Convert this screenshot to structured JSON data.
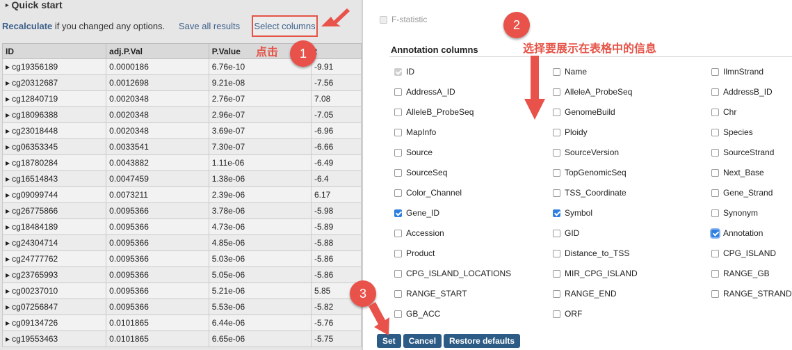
{
  "left": {
    "quick_start": "Quick start",
    "recalculate": "Recalculate",
    "recalc_suffix": " if you changed any options.",
    "save_all": "Save all results",
    "select_columns": "Select columns",
    "headers": [
      "ID",
      "adj.P.Val",
      "P.Value",
      "t"
    ],
    "rows": [
      [
        "cg19356189",
        "0.0000186",
        "6.76e-10",
        "-9.91"
      ],
      [
        "cg20312687",
        "0.0012698",
        "9.21e-08",
        "-7.56"
      ],
      [
        "cg12840719",
        "0.0020348",
        "2.76e-07",
        "7.08"
      ],
      [
        "cg18096388",
        "0.0020348",
        "2.96e-07",
        "-7.05"
      ],
      [
        "cg23018448",
        "0.0020348",
        "3.69e-07",
        "-6.96"
      ],
      [
        "cg06353345",
        "0.0033541",
        "7.30e-07",
        "-6.66"
      ],
      [
        "cg18780284",
        "0.0043882",
        "1.11e-06",
        "-6.49"
      ],
      [
        "cg16514843",
        "0.0047459",
        "1.38e-06",
        "-6.4"
      ],
      [
        "cg09099744",
        "0.0073211",
        "2.39e-06",
        "6.17"
      ],
      [
        "cg26775866",
        "0.0095366",
        "3.78e-06",
        "-5.98"
      ],
      [
        "cg18484189",
        "0.0095366",
        "4.73e-06",
        "-5.89"
      ],
      [
        "cg24304714",
        "0.0095366",
        "4.85e-06",
        "-5.88"
      ],
      [
        "cg24777762",
        "0.0095366",
        "5.03e-06",
        "-5.86"
      ],
      [
        "cg23765993",
        "0.0095366",
        "5.05e-06",
        "-5.86"
      ],
      [
        "cg00237010",
        "0.0095366",
        "5.21e-06",
        "5.85"
      ],
      [
        "cg07256847",
        "0.0095366",
        "5.53e-06",
        "-5.82"
      ],
      [
        "cg09134726",
        "0.0101865",
        "6.44e-06",
        "-5.76"
      ],
      [
        "cg19553463",
        "0.0101865",
        "6.65e-06",
        "-5.75"
      ]
    ]
  },
  "right": {
    "f_statistic": "F-statistic",
    "annotation_title": "Annotation columns",
    "options": [
      {
        "label": "ID",
        "checked": true,
        "disabled": true
      },
      {
        "label": "Name",
        "checked": false
      },
      {
        "label": "IlmnStrand",
        "checked": false
      },
      {
        "label": "AddressA_ID",
        "checked": false
      },
      {
        "label": "AlleleA_ProbeSeq",
        "checked": false
      },
      {
        "label": "AddressB_ID",
        "checked": false
      },
      {
        "label": "AlleleB_ProbeSeq",
        "checked": false
      },
      {
        "label": "GenomeBuild",
        "checked": false
      },
      {
        "label": "Chr",
        "checked": false
      },
      {
        "label": "MapInfo",
        "checked": false
      },
      {
        "label": "Ploidy",
        "checked": false
      },
      {
        "label": "Species",
        "checked": false
      },
      {
        "label": "Source",
        "checked": false
      },
      {
        "label": "SourceVersion",
        "checked": false
      },
      {
        "label": "SourceStrand",
        "checked": false
      },
      {
        "label": "SourceSeq",
        "checked": false
      },
      {
        "label": "TopGenomicSeq",
        "checked": false
      },
      {
        "label": "Next_Base",
        "checked": false
      },
      {
        "label": "Color_Channel",
        "checked": false
      },
      {
        "label": "TSS_Coordinate",
        "checked": false
      },
      {
        "label": "Gene_Strand",
        "checked": false
      },
      {
        "label": "Gene_ID",
        "checked": true
      },
      {
        "label": "Symbol",
        "checked": true
      },
      {
        "label": "Synonym",
        "checked": false
      },
      {
        "label": "Accession",
        "checked": false
      },
      {
        "label": "GID",
        "checked": false
      },
      {
        "label": "Annotation",
        "checked": true,
        "focus": true
      },
      {
        "label": "Product",
        "checked": false
      },
      {
        "label": "Distance_to_TSS",
        "checked": false
      },
      {
        "label": "CPG_ISLAND",
        "checked": false
      },
      {
        "label": "CPG_ISLAND_LOCATIONS",
        "checked": false
      },
      {
        "label": "MIR_CPG_ISLAND",
        "checked": false
      },
      {
        "label": "RANGE_GB",
        "checked": false
      },
      {
        "label": "RANGE_START",
        "checked": false
      },
      {
        "label": "RANGE_END",
        "checked": false
      },
      {
        "label": "RANGE_STRAND",
        "checked": false
      },
      {
        "label": "GB_ACC",
        "checked": false
      },
      {
        "label": "ORF",
        "checked": false
      }
    ],
    "buttons": {
      "set": "Set",
      "cancel": "Cancel",
      "restore": "Restore defaults"
    }
  },
  "annotations": {
    "click_text": "点击",
    "select_text": "选择要展示在表格中的信息",
    "step1": "1",
    "step2": "2",
    "step3": "3",
    "color": "#e55347"
  }
}
